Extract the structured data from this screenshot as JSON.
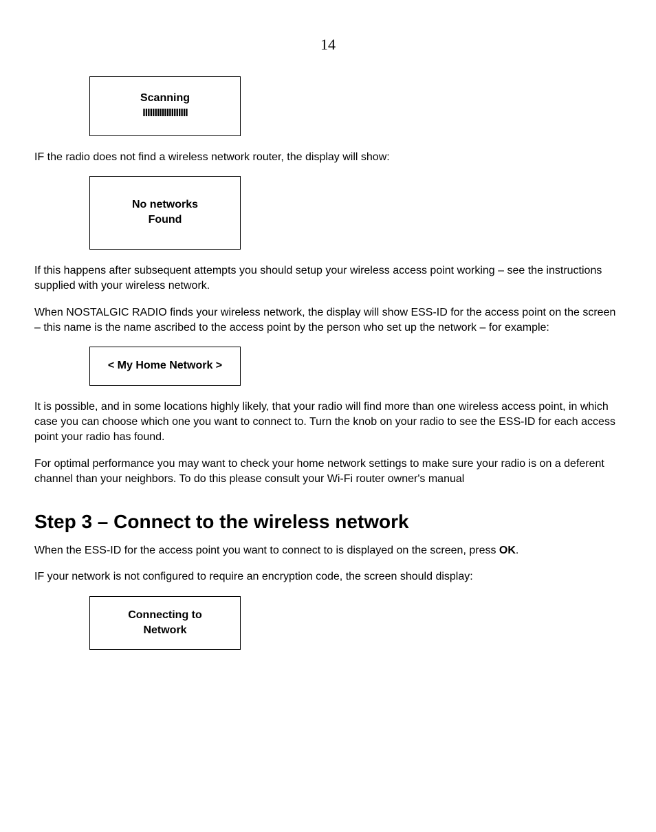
{
  "page_number": "14",
  "screen1": {
    "line1": "Scanning",
    "line2": "IIIIIIIIIIIIIIIIIII"
  },
  "p1": "IF the radio does not find a wireless network router, the display will show:",
  "screen2": {
    "line1": "No networks",
    "line2": "Found"
  },
  "p2": "If this happens after subsequent attempts you should setup your wireless access point working – see the instructions supplied with your wireless network.",
  "p3": "When NOSTALGIC RADIO finds your wireless network, the display will show ESS-ID for the access point on the screen – this name is the name ascribed to the access point by the person who set up the network – for example:",
  "screen3": {
    "line1": "<  My Home Network  >"
  },
  "p4": "It is possible, and in some locations highly likely, that your radio will find more than one wireless access point, in which case you can choose which one you want to connect to. Turn the knob on your radio to see the ESS-ID for each access point your radio has found.",
  "p5": "For optimal performance you may want to check your home network settings to make sure your radio is on a deferent channel than your neighbors. To do this please consult your Wi-Fi router owner's manual",
  "heading": "Step 3 – Connect to the wireless network",
  "p6_a": "When the ESS-ID for the access point you want to connect to is displayed on the screen, press ",
  "p6_b": "OK",
  "p6_c": ".",
  "p7": "IF your network is not configured to require an encryption code, the screen should display:",
  "screen4": {
    "line1": "Connecting to",
    "line2": "Network"
  }
}
